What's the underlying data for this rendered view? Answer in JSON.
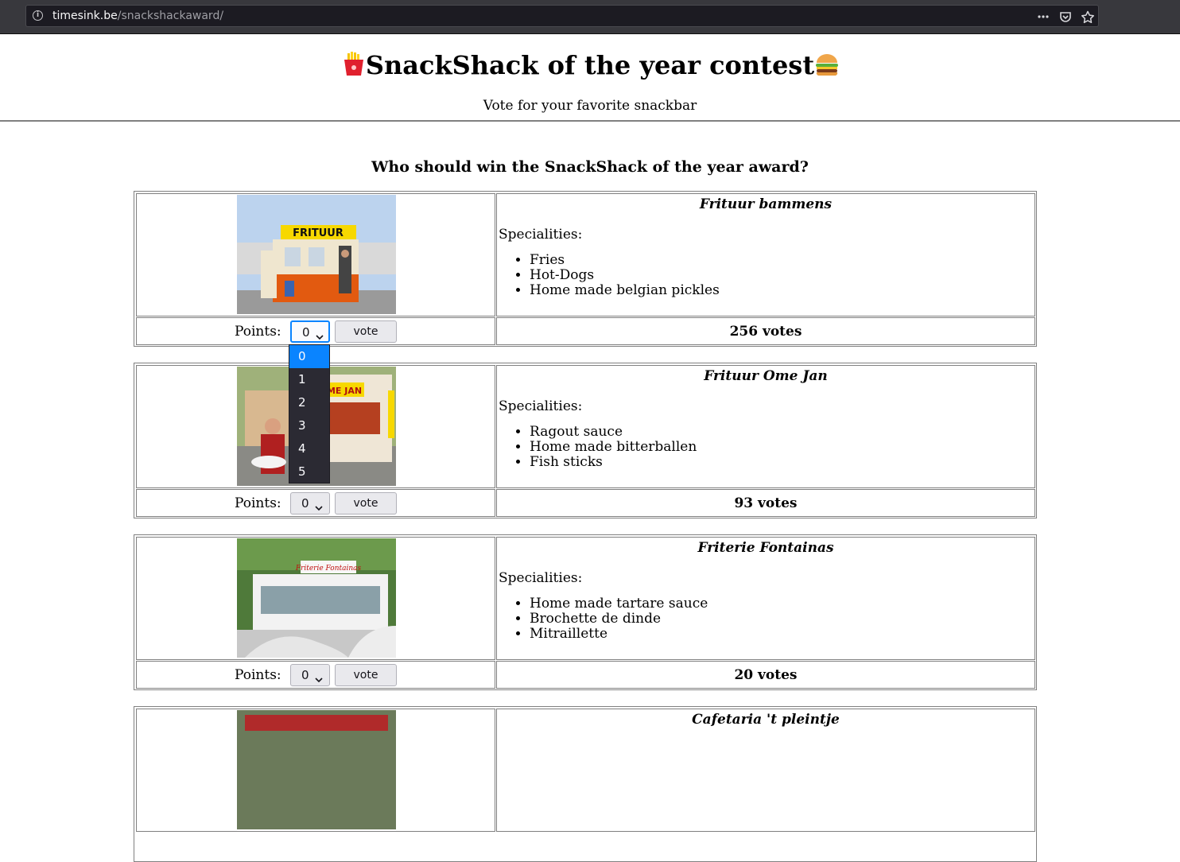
{
  "browser": {
    "url_host": "timesink.be",
    "url_path": "/snackshackaward/",
    "menu_icon": "more-horizontal-icon",
    "pocket_icon": "pocket-icon",
    "bookmark_icon": "star-icon"
  },
  "header": {
    "title": "SnackShack of the year contest",
    "title_left_icon": "fries-emoji",
    "title_right_icon": "burger-emoji",
    "subtitle": "Vote for your favorite snackbar"
  },
  "question": "Who should win the SnackShack of the year award?",
  "labels": {
    "specialities": "Specialities:",
    "points": "Points:",
    "vote_button": "vote"
  },
  "entries": [
    {
      "name": "Frituur bammens",
      "specialities": [
        "Fries",
        "Hot-Dogs",
        "Home made belgian pickles"
      ],
      "points_value": "0",
      "votes": "256 votes"
    },
    {
      "name": "Frituur Ome Jan",
      "specialities": [
        "Ragout sauce",
        "Home made bitterballen",
        "Fish sticks"
      ],
      "points_value": "0",
      "votes": "93 votes"
    },
    {
      "name": "Friterie Fontainas",
      "specialities": [
        "Home made tartare sauce",
        "Brochette de dinde",
        "Mitraillette"
      ],
      "points_value": "0",
      "votes": "20 votes"
    },
    {
      "name": "Cafetaria 't pleintje"
    }
  ],
  "points_dropdown": {
    "options": [
      "0",
      "1",
      "2",
      "3",
      "4",
      "5"
    ],
    "selected": "0"
  },
  "colors": {
    "chrome_bg": "#38383d",
    "dropdown_bg": "#2b2a33",
    "dropdown_selected": "#0a84ff",
    "table_border": "#808080"
  }
}
